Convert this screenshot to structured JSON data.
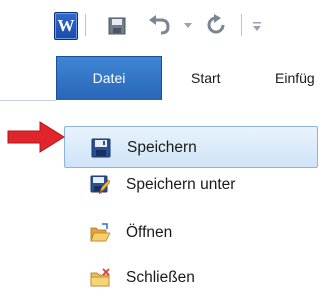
{
  "quick_access": {
    "app_logo_letter": "W",
    "icons": [
      "word-app-icon",
      "save-icon",
      "undo-icon",
      "dropdown-arrow-icon",
      "redo-icon",
      "customize-qat-icon"
    ]
  },
  "ribbon": {
    "tabs": [
      {
        "label": "Datei",
        "active": true
      },
      {
        "label": "Start",
        "active": false
      },
      {
        "label": "Einfüg",
        "active": false
      }
    ]
  },
  "backstage_menu": {
    "items": [
      {
        "label": "Speichern",
        "icon": "save-disk-icon",
        "selected": true
      },
      {
        "label": "Speichern unter",
        "icon": "save-as-icon",
        "selected": false
      },
      {
        "label": "Öffnen",
        "icon": "open-folder-icon",
        "selected": false
      },
      {
        "label": "Schließen",
        "icon": "close-folder-icon",
        "selected": false
      }
    ]
  },
  "colors": {
    "file_tab": "#2f73c4",
    "selection": "#d6e8fa",
    "annotation_arrow": "#e0262b"
  }
}
